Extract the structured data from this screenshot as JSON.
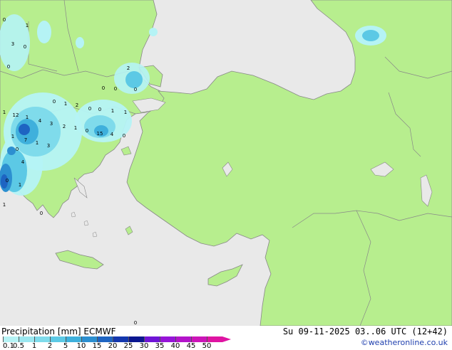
{
  "header": {
    "title_label": "Precipitation [mm]",
    "model": "ECMWF",
    "datetime": "Su 09-11-2025 03..06 UTC (12+42)",
    "credit": "©weatheronline.co.uk"
  },
  "legend": {
    "ticks": [
      "0.1",
      "0.5",
      "1",
      "2",
      "5",
      "10",
      "15",
      "20",
      "25",
      "30",
      "35",
      "40",
      "45",
      "50"
    ],
    "colors": [
      "#b5f3f5",
      "#9be7f0",
      "#7fdbeb",
      "#5cc9e5",
      "#3fb0dc",
      "#2c8fd0",
      "#1e64c2",
      "#1437ad",
      "#0b1690",
      "#6f14d6",
      "#9614d8",
      "#b314ca",
      "#cc14b8",
      "#df14a2"
    ]
  },
  "map": {
    "colors": {
      "sea": "#e9e9e9",
      "land": "#b7ee8e",
      "border": "#888888"
    },
    "precip_values": [
      "0",
      "1",
      "3",
      "0",
      "0",
      "2",
      "0",
      "0",
      "0",
      "2",
      "1",
      "0",
      "1",
      "12",
      "1",
      "4",
      "3",
      "2",
      "1",
      "0",
      "15",
      "4",
      "0",
      "1",
      "7",
      "1",
      "3",
      "4",
      "0",
      "1",
      "0",
      "1",
      "0",
      "0",
      "1",
      "0",
      "1",
      "0"
    ]
  }
}
